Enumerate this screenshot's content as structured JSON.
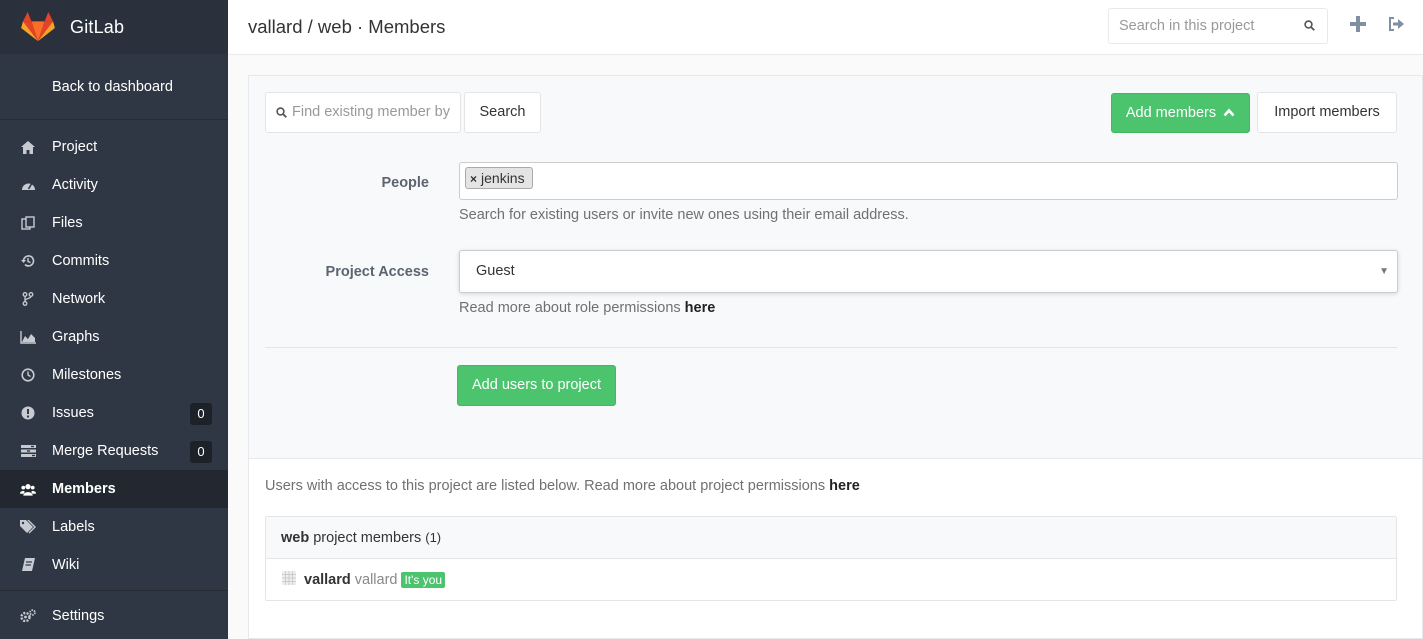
{
  "brand": {
    "name": "GitLab"
  },
  "sidebar": {
    "back_label": "Back to dashboard",
    "items": [
      {
        "label": "Project",
        "icon": "home-icon"
      },
      {
        "label": "Activity",
        "icon": "dashboard-icon"
      },
      {
        "label": "Files",
        "icon": "files-icon"
      },
      {
        "label": "Commits",
        "icon": "history-icon"
      },
      {
        "label": "Network",
        "icon": "code-fork-icon"
      },
      {
        "label": "Graphs",
        "icon": "area-chart-icon"
      },
      {
        "label": "Milestones",
        "icon": "clock-icon"
      },
      {
        "label": "Issues",
        "icon": "exclamation-circle-icon",
        "count": "0"
      },
      {
        "label": "Merge Requests",
        "icon": "tasks-icon",
        "count": "0"
      },
      {
        "label": "Members",
        "icon": "users-icon",
        "active": true
      },
      {
        "label": "Labels",
        "icon": "tags-icon"
      },
      {
        "label": "Wiki",
        "icon": "book-icon"
      },
      {
        "label": "Settings",
        "icon": "cogs-icon"
      }
    ]
  },
  "header": {
    "title": "vallard / web · Members",
    "search_placeholder": "Search in this project"
  },
  "toolbar": {
    "member_search_placeholder": "Find existing member by",
    "search_label": "Search",
    "add_members_label": "Add members",
    "import_members_label": "Import members"
  },
  "form": {
    "people_label": "People",
    "people_token": "jenkins",
    "people_help": "Search for existing users or invite new ones using their email address.",
    "access_label": "Project Access",
    "access_value": "Guest",
    "access_help": "Read more about role permissions",
    "access_help_link": "here",
    "submit_label": "Add users to project"
  },
  "members": {
    "info": "Users with access to this project are listed below. Read more about project permissions",
    "info_link": "here",
    "group_name": "web",
    "group_suffix": "project members",
    "group_count": "(1)",
    "rows": [
      {
        "name": "vallard",
        "handle": "vallard",
        "badge": "It's you"
      }
    ]
  },
  "colors": {
    "sidebar_bg": "#303744",
    "accent_green": "#4cc46e",
    "logo_orange": "#e24329"
  }
}
